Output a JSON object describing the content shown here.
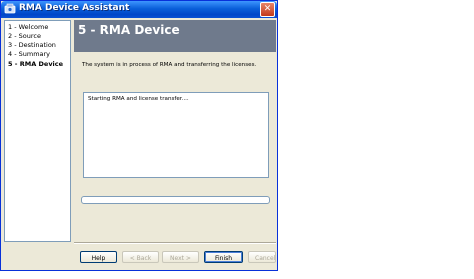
{
  "window": {
    "title": "RMA Device Assistant",
    "close_glyph": "✕"
  },
  "steps": [
    {
      "label": "1 - Welcome",
      "active": false
    },
    {
      "label": "2 - Source",
      "active": false
    },
    {
      "label": "3 - Destination",
      "active": false
    },
    {
      "label": "4 - Summary",
      "active": false
    },
    {
      "label": "5 - RMA Device",
      "active": true
    }
  ],
  "header": {
    "title": "5 - RMA Device"
  },
  "status_message": "The system is in process of RMA and transferring the licenses.",
  "log": {
    "text": "Starting RMA and license transfer...."
  },
  "progress": {
    "fraction": 0.0
  },
  "buttons": {
    "help": "Help",
    "back": "< Back",
    "next": "Next >",
    "finish": "Finish",
    "cancel": "Cancel"
  },
  "colors": {
    "titlebar": "#0a5fd9",
    "header_bg": "#6f7a8c",
    "window_bg": "#ece9d8"
  }
}
